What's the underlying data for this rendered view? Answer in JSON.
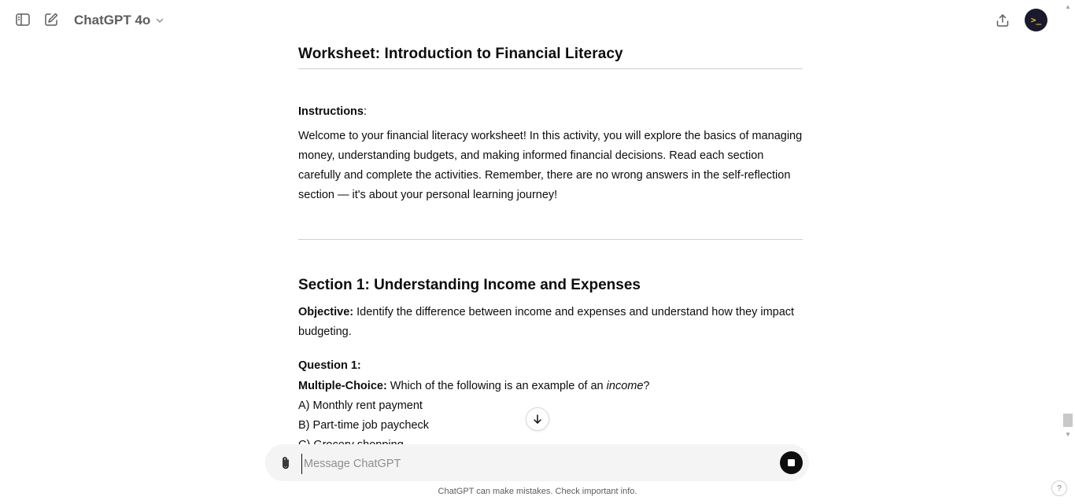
{
  "topbar": {
    "model_name": "ChatGPT 4o",
    "avatar_glyph": ">_"
  },
  "doc": {
    "title": "Worksheet: Introduction to Financial Literacy",
    "instructions_label": "Instructions",
    "instructions_colon": ":",
    "instructions_text": "Welcome to your financial literacy worksheet! In this activity, you will explore the basics of managing money, understanding budgets, and making informed financial decisions. Read each section carefully and complete the activities. Remember, there are no wrong answers in the self-reflection section — it's about your personal learning journey!",
    "section1_title": "Section 1: Understanding Income and Expenses",
    "objective_label": "Objective:",
    "objective_text": " Identify the difference between income and expenses and understand how they impact budgeting.",
    "question1_label": "Question 1:",
    "mc_label": "Multiple-Choice:",
    "mc_text_before": " Which of the following is an example of an ",
    "mc_text_italic": "income",
    "mc_text_after": "?",
    "options": [
      "A) Monthly rent payment",
      "B) Part-time job paycheck",
      "C) Grocery shopping"
    ]
  },
  "composer": {
    "placeholder": "Message ChatGPT"
  },
  "footer": {
    "disclaimer": "ChatGPT can make mistakes. Check important info.",
    "help": "?"
  },
  "colors": {
    "background": "#ffffff",
    "text": "#0d0d0d",
    "muted": "#5d5d5d",
    "composer_bg": "#f4f4f4"
  },
  "icons": [
    "sidebar-toggle-icon",
    "new-chat-icon",
    "chevron-down-icon",
    "share-icon",
    "paperclip-icon",
    "arrow-down-icon",
    "stop-icon"
  ]
}
